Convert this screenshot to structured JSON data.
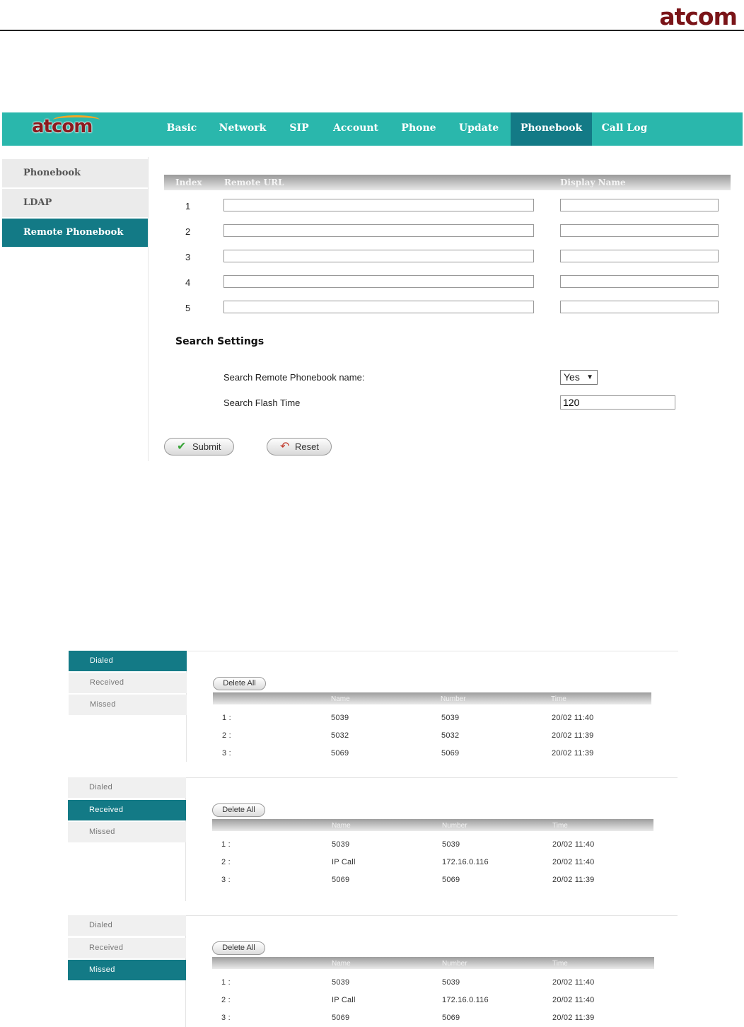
{
  "doc_logo": "atcom",
  "panel1": {
    "brand": "atcom",
    "nav": [
      {
        "label": "Basic"
      },
      {
        "label": "Network"
      },
      {
        "label": "SIP"
      },
      {
        "label": "Account"
      },
      {
        "label": "Phone"
      },
      {
        "label": "Update"
      },
      {
        "label": "Phonebook",
        "active": true
      },
      {
        "label": "Call Log"
      }
    ],
    "sidebar": [
      {
        "label": "Phonebook"
      },
      {
        "label": "LDAP"
      },
      {
        "label": "Remote Phonebook",
        "active": true
      }
    ],
    "table": {
      "headers": {
        "index": "Index",
        "url": "Remote URL",
        "name": "Display Name"
      },
      "rows": [
        {
          "index": "1",
          "url": "",
          "name": ""
        },
        {
          "index": "2",
          "url": "",
          "name": ""
        },
        {
          "index": "3",
          "url": "",
          "name": ""
        },
        {
          "index": "4",
          "url": "",
          "name": ""
        },
        {
          "index": "5",
          "url": "",
          "name": ""
        }
      ]
    },
    "search": {
      "title": "Search Settings",
      "name_label": "Search Remote Phonebook name:",
      "name_value": "Yes",
      "flash_label": "Search Flash Time",
      "flash_value": "120"
    },
    "buttons": {
      "submit": "Submit",
      "reset": "Reset"
    }
  },
  "call_logs": [
    {
      "tabs": [
        "Dialed",
        "Received",
        "Missed"
      ],
      "active_tab": "Dialed",
      "delete_label": "Delete All",
      "headers": {
        "name": "Name",
        "number": "Number",
        "time": "Time"
      },
      "rows": [
        {
          "idx": "1 :",
          "name": "5039",
          "number": "5039",
          "time": "20/02 11:40"
        },
        {
          "idx": "2 :",
          "name": "5032",
          "number": "5032",
          "time": "20/02 11:39"
        },
        {
          "idx": "3 :",
          "name": "5069",
          "number": "5069",
          "time": "20/02 11:39"
        }
      ]
    },
    {
      "tabs": [
        "Dialed",
        "Received",
        "Missed"
      ],
      "active_tab": "Received",
      "delete_label": "Delete All",
      "headers": {
        "name": "Name",
        "number": "Number",
        "time": "Time"
      },
      "rows": [
        {
          "idx": "1 :",
          "name": "5039",
          "number": "5039",
          "time": "20/02 11:40"
        },
        {
          "idx": "2 :",
          "name": "IP Call",
          "number": "172.16.0.116",
          "time": "20/02 11:40"
        },
        {
          "idx": "3 :",
          "name": "5069",
          "number": "5069",
          "time": "20/02 11:39"
        }
      ]
    },
    {
      "tabs": [
        "Dialed",
        "Received",
        "Missed"
      ],
      "active_tab": "Missed",
      "delete_label": "Delete All",
      "headers": {
        "name": "Name",
        "number": "Number",
        "time": "Time"
      },
      "rows": [
        {
          "idx": "1 :",
          "name": "5039",
          "number": "5039",
          "time": "20/02 11:40"
        },
        {
          "idx": "2 :",
          "name": "IP Call",
          "number": "172.16.0.116",
          "time": "20/02 11:40"
        },
        {
          "idx": "3 :",
          "name": "5069",
          "number": "5069",
          "time": "20/02 11:39"
        }
      ]
    }
  ],
  "colors": {
    "teal": "#2ab7ac",
    "dark_teal": "#137a86",
    "brand_red": "#8b1a1e"
  }
}
